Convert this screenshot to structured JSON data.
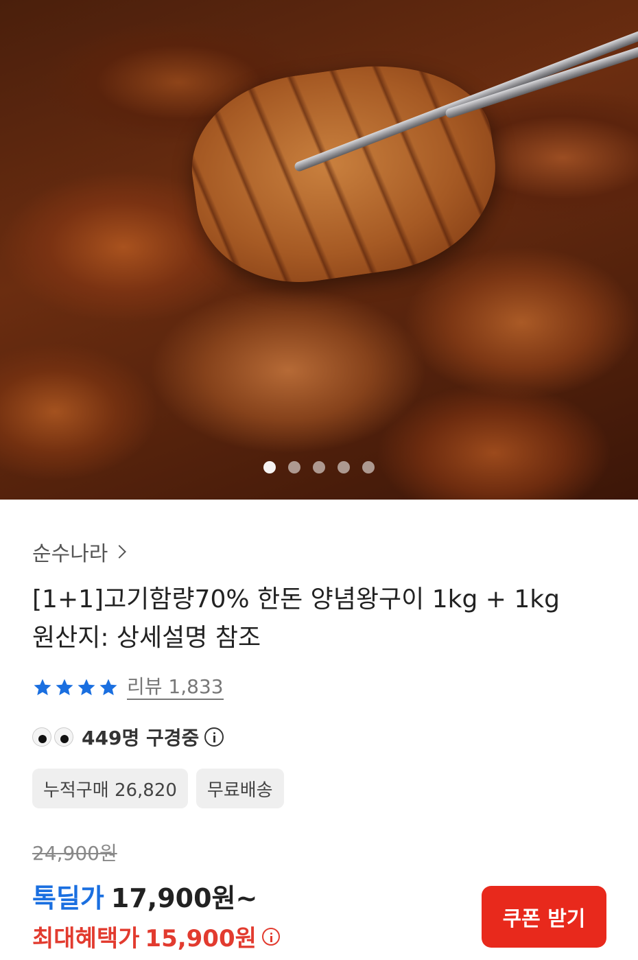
{
  "carousel": {
    "total": 5,
    "active_index": 0
  },
  "product": {
    "brand": "순수나라",
    "title_line1": "[1+1]고기함량70% 한돈 양념왕구이 1kg + 1kg",
    "title_line2": "원산지: 상세설명 참조",
    "rating_stars": 4,
    "review_label": "리뷰 1,833",
    "viewers_text": "449명 구경중",
    "tags": [
      "누적구매 26,820",
      "무료배송"
    ],
    "original_price": "24,900원",
    "deal_label": "톡딜가",
    "deal_price": "17,900원~",
    "max_benefit_label": "최대혜택가",
    "max_benefit_price": "15,900원",
    "coupon_button": "쿠폰 받기"
  },
  "colors": {
    "accent_blue": "#1a6fe0",
    "accent_red": "#e23b2f",
    "button_red": "#e8291c"
  }
}
